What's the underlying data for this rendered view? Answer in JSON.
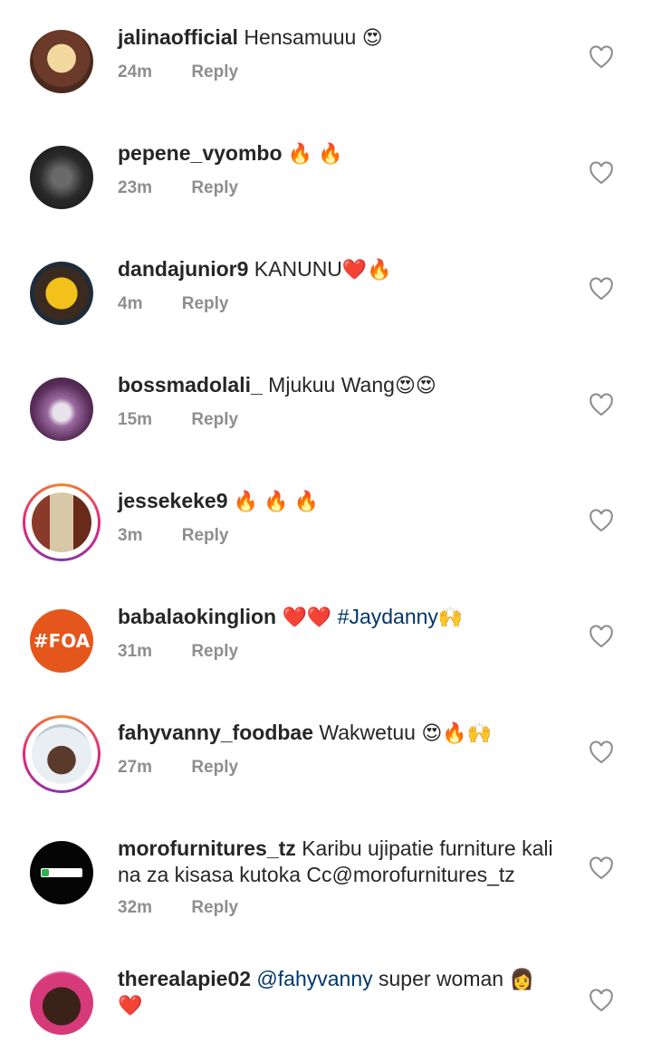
{
  "reply_label": "Reply",
  "comments": [
    {
      "user": "jalinaofficial",
      "text": "Hensamuuu",
      "emoji": "😍",
      "time": "24m"
    },
    {
      "user": "pepene_vyombo",
      "text": "",
      "emoji": "🔥 🔥",
      "time": "23m"
    },
    {
      "user": "dandajunior9",
      "text": "KANUNU",
      "emoji": "❤️🔥",
      "time": "4m"
    },
    {
      "user": "bossmadolali_",
      "text": "Mjukuu Wang",
      "emoji": "😍😍",
      "time": "15m"
    },
    {
      "user": "jessekeke9",
      "text": "",
      "emoji": "🔥 🔥 🔥",
      "time": "3m"
    },
    {
      "user": "babalaokinglion",
      "text": "❤️❤️",
      "tag": "#Jaydanny",
      "emoji": "🙌",
      "time": "31m",
      "avatar_text": "#FOA"
    },
    {
      "user": "fahyvanny_foodbae",
      "text": "Wakwetuu",
      "emoji": "😍🔥🙌",
      "time": "27m"
    },
    {
      "user": "morofurnitures_tz",
      "text": "Karibu ujipatie furniture kali",
      "text2": "na za kisasa kutoka Cc@morofurnitures_tz",
      "time": "32m"
    },
    {
      "user": "therealapie02",
      "tag": "@fahyvanny",
      "text": "super woman",
      "emoji": "👩",
      "emoji2": "❤️"
    }
  ]
}
